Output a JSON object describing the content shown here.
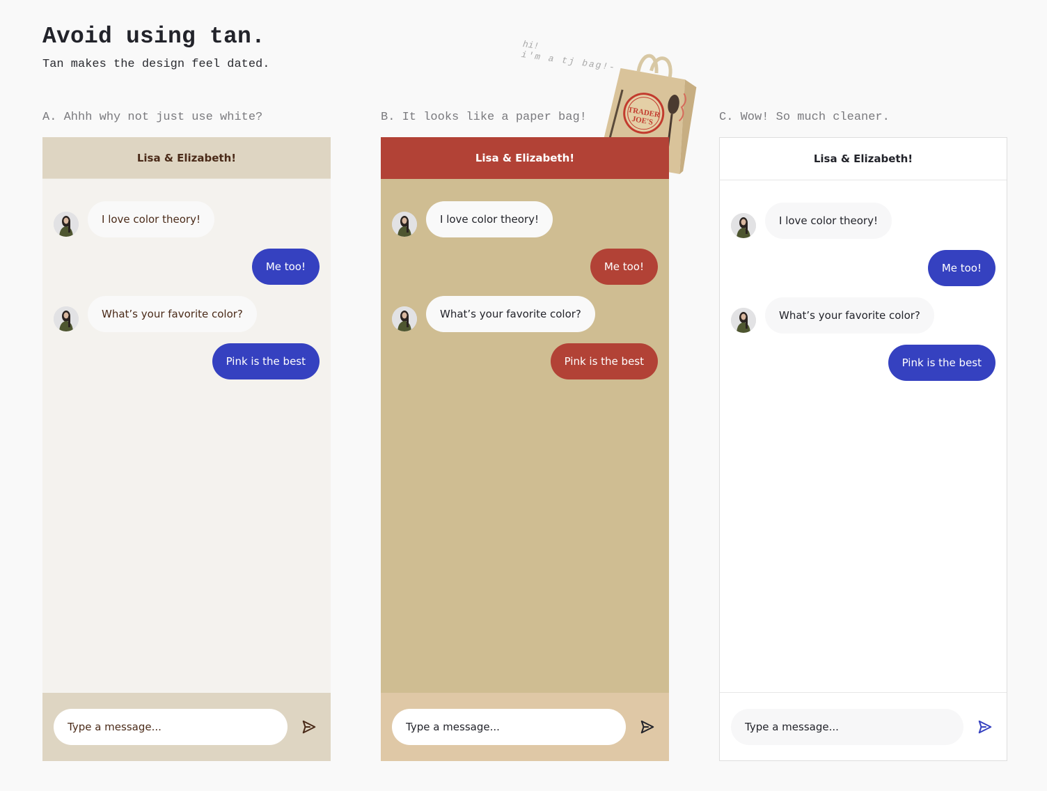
{
  "page": {
    "title": "Avoid using tan.",
    "subtitle": "Tan makes the design feel dated."
  },
  "note": {
    "line1": "hi!",
    "line2": "i'm a tj bag!-"
  },
  "bag": {
    "icon": "trader-joes-bag-image",
    "line1": "TRADER",
    "line2": "JOE'S"
  },
  "panels": [
    {
      "label": "A. Ahhh why not just use white?",
      "header": "Lisa & Elizabeth!",
      "messages": [
        {
          "direction": "incoming",
          "text": "I love color theory!"
        },
        {
          "direction": "outgoing",
          "text": "Me too!"
        },
        {
          "direction": "incoming",
          "text": "What’s your favorite color?"
        },
        {
          "direction": "outgoing",
          "text": "Pink is the best"
        }
      ],
      "input_placeholder": "Type a message...",
      "send_icon": "send-icon",
      "colors": {
        "header_bg": "#ded5c2",
        "body_bg": "#f4f2ee",
        "outgoing_bubble": "#3541c0",
        "text": "#4a2a18",
        "send_icon": "#4a2a18"
      }
    },
    {
      "label": "B. It looks like a paper bag!",
      "header": "Lisa & Elizabeth!",
      "messages": [
        {
          "direction": "incoming",
          "text": "I love color theory!"
        },
        {
          "direction": "outgoing",
          "text": "Me too!"
        },
        {
          "direction": "incoming",
          "text": "What’s your favorite color?"
        },
        {
          "direction": "outgoing",
          "text": "Pink is the best"
        }
      ],
      "input_placeholder": "Type a message...",
      "send_icon": "send-icon",
      "colors": {
        "header_bg": "#b24236",
        "body_bg": "#cfbd92",
        "outgoing_bubble": "#b24236",
        "text": "#22232a",
        "send_icon": "#22232a"
      }
    },
    {
      "label": "C. Wow! So much cleaner.",
      "header": "Lisa & Elizabeth!",
      "messages": [
        {
          "direction": "incoming",
          "text": "I love color theory!"
        },
        {
          "direction": "outgoing",
          "text": "Me too!"
        },
        {
          "direction": "incoming",
          "text": "What’s your favorite color?"
        },
        {
          "direction": "outgoing",
          "text": "Pink is the best"
        }
      ],
      "input_placeholder": "Type a message...",
      "send_icon": "send-icon",
      "colors": {
        "header_bg": "#ffffff",
        "body_bg": "#ffffff",
        "outgoing_bubble": "#3541c0",
        "text": "#22232a",
        "send_icon": "#3541c0"
      }
    }
  ]
}
